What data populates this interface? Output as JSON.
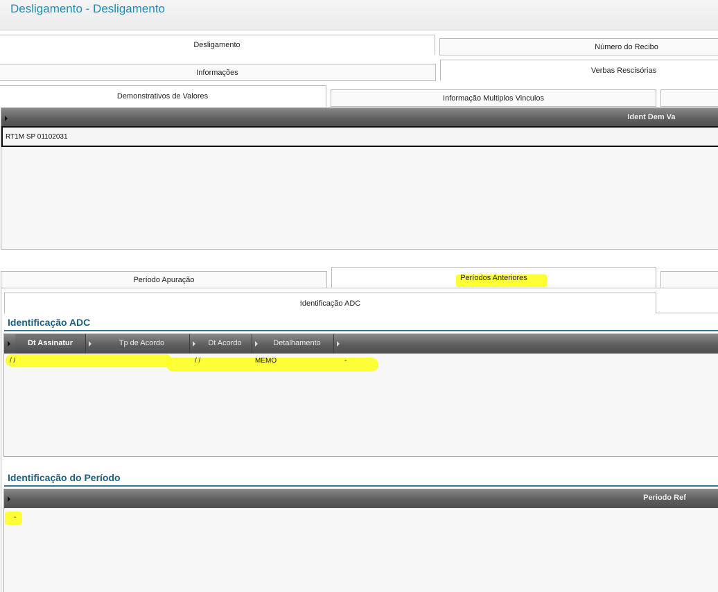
{
  "window": {
    "title": "Desligamento - Desligamento"
  },
  "tabs_row1": [
    {
      "label": "Desligamento"
    },
    {
      "label": "Número do Recibo"
    }
  ],
  "tabs_row2": [
    {
      "label": "Informações"
    },
    {
      "label": "Verbas Rescisórias"
    }
  ],
  "tabs_row3": [
    {
      "label": "Demonstrativos de Valores"
    },
    {
      "label": "Informação Multiplos Vinculos"
    }
  ],
  "grid_demonstrativos": {
    "column": "Ident Dem Va",
    "rows": [
      {
        "ident": "RT1M SP 01102031"
      }
    ]
  },
  "tabs_periodo": [
    {
      "label": "Período Apuração"
    },
    {
      "label": "Períodos Anteriores"
    }
  ],
  "subtab": {
    "label": "Identificação ADC"
  },
  "section_adc": {
    "title": "Identificação ADC",
    "columns": [
      "Dt Assinatur",
      "Tp de Acordo",
      "Dt Acordo",
      "Detalhamento"
    ],
    "row": {
      "dt_assinatura": " /  /",
      "tp_acordo": "",
      "dt_acordo": " /  /",
      "detalhamento": "MEMO",
      "extra": "-"
    }
  },
  "section_periodo": {
    "title": "Identificação do Período",
    "column": "Periodo Ref",
    "row": {
      "periodo_ref": "-"
    }
  },
  "colors": {
    "title": "#1a8fb5",
    "section_title": "#1d5f7a",
    "highlight": "#ffff22"
  }
}
